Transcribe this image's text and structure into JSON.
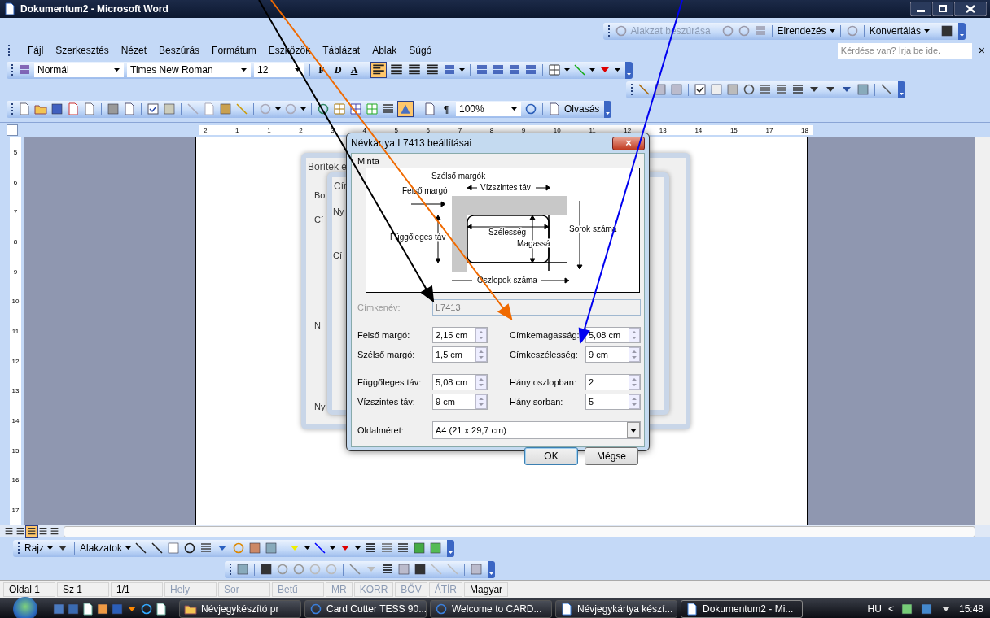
{
  "window": {
    "title": "Dokumentum2 - Microsoft Word"
  },
  "diagram_toolbar": {
    "items": [
      {
        "label": "Alakzat beszúrása",
        "disabled": true
      },
      {
        "label": "Elrendezés",
        "disabled": false
      },
      {
        "label": "Konvertálás",
        "disabled": false
      }
    ]
  },
  "menu": [
    "Fájl",
    "Szerkesztés",
    "Nézet",
    "Beszúrás",
    "Formátum",
    "Eszközök",
    "Táblázat",
    "Ablak",
    "Súgó"
  ],
  "help_field": {
    "placeholder": "Kérdése van? Írja be ide.",
    "close": "×"
  },
  "formatting_toolbar": {
    "style": "Normál",
    "font": "Times New Roman",
    "size": "12",
    "text_buttons": [
      "F",
      "D",
      "A"
    ],
    "alignment": [
      {
        "selected": true
      },
      {
        "selected": false
      },
      {
        "selected": false
      },
      {
        "selected": false
      }
    ]
  },
  "standard_toolbar": {
    "toggle": {
      "selected": true
    },
    "pilcrow": "¶",
    "zoom": "100%",
    "read_button": "Olvasás"
  },
  "ruler": {
    "labels": [
      "2",
      "1",
      "1",
      "2",
      "3",
      "4",
      "5",
      "6",
      "7",
      "8",
      "9",
      "10",
      "11",
      "12",
      "13",
      "14",
      "15",
      "17",
      "18"
    ]
  },
  "vertical_ruler": {
    "labels": [
      "5",
      "6",
      "7",
      "8",
      "9",
      "10",
      "11",
      "12",
      "13",
      "14",
      "15",
      "16",
      "17"
    ]
  },
  "back_dialogs": [
    {
      "title": "Boríték é",
      "fragments": [
        "Bo",
        "Cí",
        "N",
        "Ny"
      ]
    },
    {
      "title": "Cír",
      "fragments": [
        "Ny",
        "Cí"
      ]
    }
  ],
  "dialog": {
    "title": "Névkártya L7413 beállításai",
    "close": "×",
    "group": "Minta",
    "diagram_labels": [
      "Szélső margók",
      "Felső margó",
      "Vízszintes táv",
      "Függőleges táv",
      "Szélesség",
      "Magassá",
      "Sorok száma",
      "Oszlopok száma"
    ],
    "name_field": {
      "label": "Címkenév:",
      "value": "L7413",
      "disabled": true
    },
    "fields": [
      {
        "label": "Felső margó:",
        "value": "2,15 cm"
      },
      {
        "label": "Címkemagasság:",
        "value": "5,08 cm"
      },
      {
        "label": "Szélső margó:",
        "value": "1,5 cm"
      },
      {
        "label": "Címkeszélesség:",
        "value": "9 cm"
      },
      {
        "label": "Függőleges táv:",
        "value": "5,08 cm"
      },
      {
        "label": "Hány oszlopban:",
        "value": "2"
      },
      {
        "label": "Vízszintes táv:",
        "value": "9 cm"
      },
      {
        "label": "Hány sorban:",
        "value": "5"
      }
    ],
    "page_size": {
      "label": "Oldalméret:",
      "value": "A4 (21 x 29,7 cm)"
    },
    "buttons": [
      {
        "label": "OK",
        "default": true
      },
      {
        "label": "Mégse",
        "default": false
      }
    ]
  },
  "views": [
    {
      "selected": false
    },
    {
      "selected": false
    },
    {
      "selected": true
    },
    {
      "selected": false
    },
    {
      "selected": false
    }
  ],
  "drawing_toolbar": {
    "draw": "Rajz",
    "shapes": "Alakzatok"
  },
  "status_bar": [
    {
      "text": "Oldal 1",
      "disabled": false
    },
    {
      "text": "Sz 1",
      "disabled": false
    },
    {
      "text": "1/1",
      "disabled": false
    },
    {
      "text": "Hely",
      "disabled": true
    },
    {
      "text": "Sor",
      "disabled": true
    },
    {
      "text": "Betű",
      "disabled": true
    },
    {
      "text": "MR",
      "disabled": true
    },
    {
      "text": "KORR",
      "disabled": true
    },
    {
      "text": "BŐV",
      "disabled": true
    },
    {
      "text": "ÁTÍR",
      "disabled": true
    },
    {
      "text": "Magyar",
      "disabled": false
    }
  ],
  "taskbar": {
    "tasks": [
      {
        "label": "Névjegykészító pr",
        "selected": false
      },
      {
        "label": "Card Cutter TESS 90...",
        "selected": false
      },
      {
        "label": "Welcome to CARD...",
        "selected": false
      },
      {
        "label": "Névjegykártya készí...",
        "selected": false
      },
      {
        "label": "Dokumentum2 - Mi...",
        "selected": true
      }
    ],
    "language": "HU",
    "tray_arrow": "<",
    "clock": "15:48"
  }
}
